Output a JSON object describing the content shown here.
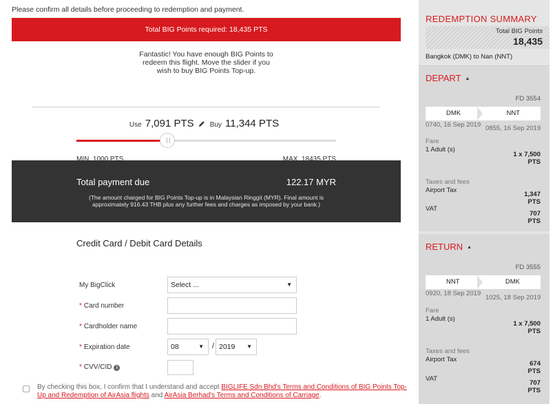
{
  "intro_text": "Please confirm all details before proceeding to redemption and payment.",
  "points_required": "Total BIG Points required: 18,435 PTS",
  "message_lines": [
    "Fantastic! You have enough BIG Points to",
    "redeem this flight. Move the slider if you",
    "wish to buy BIG Points Top-up."
  ],
  "slider": {
    "use_label": "Use",
    "use_value": "7,091 PTS",
    "buy_label": "Buy",
    "buy_value": "11,344 PTS",
    "min_label": "MIN. 1000 PTS",
    "max_label": "MAX. 18435 PTS",
    "min": 1000,
    "max": 18435,
    "value": 7091
  },
  "payment": {
    "total_label": "Total payment due",
    "total_value": "122.17 MYR",
    "note_line1": "(The amount charged for BIG Points Top-up is in Malaysian Ringgit (MYR). Final amount is",
    "note_line2": "approximately 916.43 THB plus any further fees and charges as imposed by your bank.)"
  },
  "card_form": {
    "title": "Credit Card / Debit Card Details",
    "bigclick_label": "My BigClick",
    "bigclick_value": "Select ...",
    "card_number_label": "Card number",
    "cardholder_label": "Cardholder name",
    "expiration_label": "Expiration date",
    "exp_month": "08",
    "exp_separator": "/",
    "exp_year": "2019",
    "cvv_label": "CVV/CID",
    "required_mark": "*"
  },
  "terms": {
    "prefix": "By checking this box, I confirm that I understand and accept ",
    "link1": "BIGLIFE Sdn Bhd's Terms and Conditions of BIG Points Top-Up and Redemption of AirAsia flights",
    "middle": " and ",
    "link2": "AirAsia Berhad's Terms and Conditions of Carriage",
    "suffix": "."
  },
  "summary": {
    "title": "REDEMPTION SUMMARY",
    "total_label": "Total BIG Points",
    "total_value": "18,435",
    "route": "Bangkok (DMK) to Nan (NNT)",
    "depart": {
      "heading": "DEPART",
      "flight_no": "FD 3554",
      "from": "DMK",
      "to": "NNT",
      "dep_time": "0740, 16 Sep 2019",
      "arr_time": "0855, 16 Sep 2019",
      "fare_label": "Fare",
      "pax_label": "1 Adult (s)",
      "fare_value_line1": "1 x 7,500",
      "fare_value_line2": "PTS",
      "taxes_label": "Taxes and fees",
      "airport_tax_label": "Airport Tax",
      "airport_tax_value": "1,347",
      "airport_tax_unit": "PTS",
      "vat_label": "VAT",
      "vat_value": "707",
      "vat_unit": "PTS"
    },
    "return": {
      "heading": "RETURN",
      "flight_no": "FD 3555",
      "from": "NNT",
      "to": "DMK",
      "dep_time": "0920, 18 Sep 2019",
      "arr_time": "1025, 18 Sep 2019",
      "fare_label": "Fare",
      "pax_label": "1 Adult (s)",
      "fare_value_line1": "1 x 7,500",
      "fare_value_line2": "PTS",
      "taxes_label": "Taxes and fees",
      "airport_tax_label": "Airport Tax",
      "airport_tax_value": "674",
      "airport_tax_unit": "PTS",
      "vat_label": "VAT",
      "vat_value": "707",
      "vat_unit": "PTS"
    }
  },
  "colors": {
    "accent": "#d71a1f",
    "dark_panel": "#333333",
    "sidebar_bg": "#e5e5e5"
  }
}
